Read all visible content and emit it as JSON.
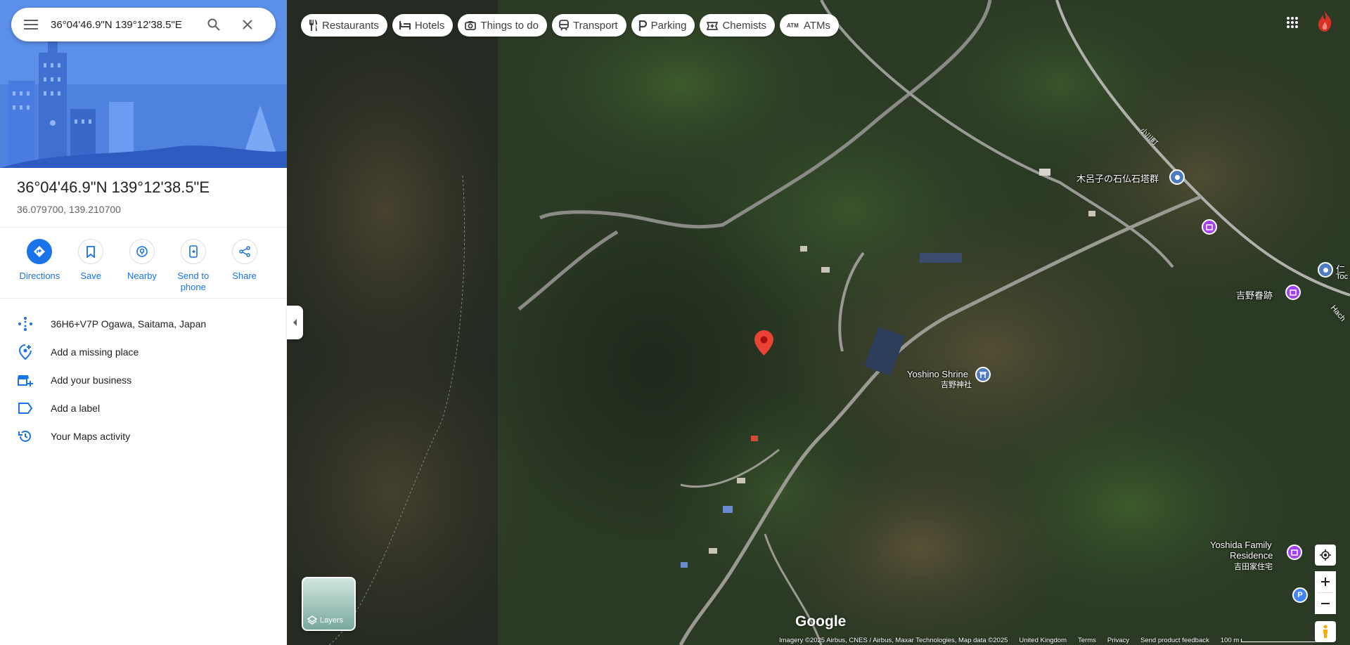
{
  "search": {
    "query": "36°04'46.9\"N 139°12'38.5\"E"
  },
  "place": {
    "title": "36°04'46.9\"N 139°12'38.5\"E",
    "coordinates": "36.079700, 139.210700"
  },
  "actions": [
    {
      "label": "Directions",
      "icon": "directions-icon"
    },
    {
      "label": "Save",
      "icon": "bookmark-icon"
    },
    {
      "label": "Nearby",
      "icon": "nearby-icon"
    },
    {
      "label": "Send to\nphone",
      "icon": "send-to-phone-icon"
    },
    {
      "label": "Share",
      "icon": "share-icon"
    }
  ],
  "info": {
    "plus_code": "36H6+V7P Ogawa, Saitama, Japan",
    "add_missing_place": "Add a missing place",
    "add_business": "Add your business",
    "add_label": "Add a label",
    "maps_activity": "Your Maps activity"
  },
  "chips": [
    {
      "label": "Restaurants",
      "icon": "restaurant-icon"
    },
    {
      "label": "Hotels",
      "icon": "hotel-icon"
    },
    {
      "label": "Things to do",
      "icon": "camera-icon"
    },
    {
      "label": "Transport",
      "icon": "transit-icon"
    },
    {
      "label": "Parking",
      "icon": "parking-icon"
    },
    {
      "label": "Chemists",
      "icon": "pharmacy-icon"
    },
    {
      "label": "ATMs",
      "icon": "atm-icon"
    }
  ],
  "map_labels": {
    "stone_buddha": "木呂子の石仏石塔群",
    "yoshino_ruins": "吉野眷跡",
    "yoshino_shrine": "Yoshino Shrine",
    "yoshino_shrine_jp": "吉野神社",
    "yoshida_line1": "Yoshida Family",
    "yoshida_line2": "Residence",
    "yoshida_jp": "吉田家住宅",
    "edge_label_jp": "仁",
    "edge_label_en": "Toc",
    "road_label_jp": "小川町",
    "road_label_en": "Hach"
  },
  "layers": {
    "label": "Layers"
  },
  "footer": {
    "attribution": "Imagery ©2025 Airbus, CNES / Airbus, Maxar Technologies, Map data ©2025",
    "region": "United Kingdom",
    "terms": "Terms",
    "privacy": "Privacy",
    "feedback": "Send product feedback",
    "scale": "100 m"
  },
  "brand": {
    "logo": "Google"
  },
  "colors": {
    "accent": "#1a73e8",
    "marker": "#ea4335",
    "poi_purple": "#a142f4",
    "poi_blue": "#4285f4"
  }
}
